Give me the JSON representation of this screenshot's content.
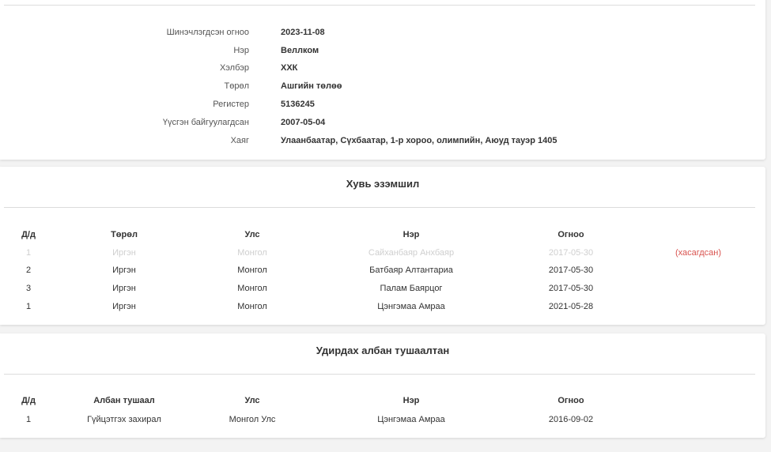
{
  "company": {
    "fields": [
      {
        "label": "Шинэчлэгдсэн огноо",
        "value": "2023-11-08"
      },
      {
        "label": "Нэр",
        "value": "Веллком"
      },
      {
        "label": "Хэлбэр",
        "value": "ХХК"
      },
      {
        "label": "Төрөл",
        "value": "Ашгийн төлөө"
      },
      {
        "label": "Регистер",
        "value": "5136245"
      },
      {
        "label": "Үүсгэн байгуулагдсан",
        "value": "2007-05-04"
      },
      {
        "label": "Хаяг",
        "value": "Улаанбаатар, Сүхбаатар, 1-р хороо, олимпийн, Аюуд тауэр 1405"
      }
    ]
  },
  "ownership": {
    "title": "Хувь эзэмшил",
    "headers": [
      "Д/д",
      "Төрөл",
      "Улс",
      "Нэр",
      "Огноо"
    ],
    "rows": [
      {
        "no": "1",
        "type": "Иргэн",
        "country": "Монгол",
        "name": "Сайханбаяр Анхбаяр",
        "date": "2017-05-30",
        "tag": "(хасагдсан)"
      },
      {
        "no": "2",
        "type": "Иргэн",
        "country": "Монгол",
        "name": "Батбаяр Алтантариа",
        "date": "2017-05-30",
        "tag": ""
      },
      {
        "no": "3",
        "type": "Иргэн",
        "country": "Монгол",
        "name": "Палам Баярцог",
        "date": "2017-05-30",
        "tag": ""
      },
      {
        "no": "1",
        "type": "Иргэн",
        "country": "Монгол",
        "name": "Цэнгэмаа Амраа",
        "date": "2021-05-28",
        "tag": ""
      }
    ],
    "removed_color": "#d9534f"
  },
  "officers": {
    "title": "Удирдах албан тушаалтан",
    "headers": [
      "Д/д",
      "Албан тушаал",
      "Улс",
      "Нэр",
      "Огноо"
    ],
    "rows": [
      {
        "no": "1",
        "position": "Гүйцэтгэх захирал",
        "country": "Монгол Улс",
        "name": "Цэнгэмаа Амраа",
        "date": "2016-09-02"
      }
    ]
  }
}
